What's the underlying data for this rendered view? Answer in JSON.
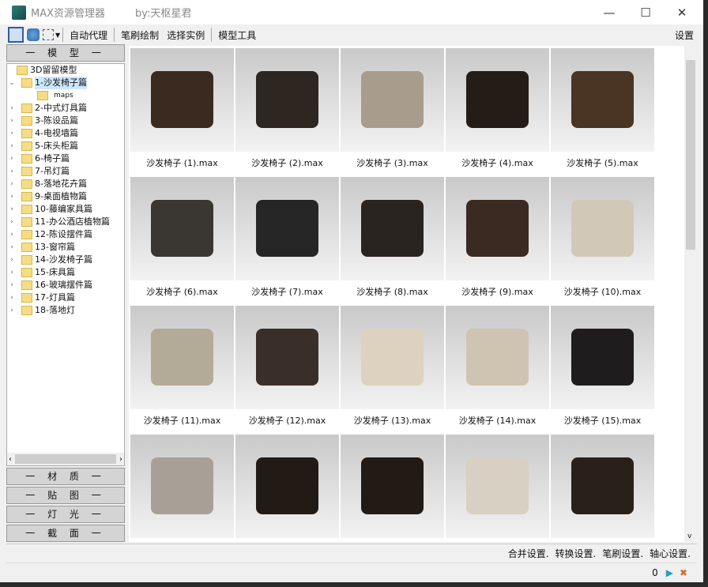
{
  "window": {
    "title": "MAX资源管理器",
    "author": "by:天枢星君",
    "minimize": "—",
    "maximize": "☐",
    "close": "✕"
  },
  "toolbar": {
    "items": [
      "自动代理",
      "笔刷绘制",
      "选择实例",
      "模型工具"
    ],
    "settings": "设置"
  },
  "left": {
    "model_header": "一 模 型 一",
    "root": "3D留留模型",
    "tree": [
      {
        "label": "1-沙发椅子篇",
        "expanded": true,
        "selected": true
      },
      {
        "label": "maps",
        "child": true
      },
      {
        "label": "2-中式灯具篇"
      },
      {
        "label": "3-陈设品篇"
      },
      {
        "label": "4-电视墙篇"
      },
      {
        "label": "5-床头柜篇"
      },
      {
        "label": "6-椅子篇"
      },
      {
        "label": "7-吊灯篇"
      },
      {
        "label": "8-落地花卉篇"
      },
      {
        "label": "9-桌面植物篇"
      },
      {
        "label": "10-藤编家具篇"
      },
      {
        "label": "11-办公酒店植物篇"
      },
      {
        "label": "12-陈设摆件篇"
      },
      {
        "label": "13-窗帘篇"
      },
      {
        "label": "14-沙发椅子篇"
      },
      {
        "label": "15-床具篇"
      },
      {
        "label": "16-玻璃摆件篇"
      },
      {
        "label": "17-灯具篇"
      },
      {
        "label": "18-落地灯"
      }
    ],
    "panels": [
      "一 材 质 一",
      "一 贴 图 一",
      "一 灯 光 一",
      "一 截 面 一"
    ]
  },
  "grid": {
    "items": [
      {
        "label": "沙发椅子 (1).max",
        "color": "#3b2a20"
      },
      {
        "label": "沙发椅子 (2).max",
        "color": "#2e2620"
      },
      {
        "label": "沙发椅子 (3).max",
        "color": "#a89c8c"
      },
      {
        "label": "沙发椅子 (4).max",
        "color": "#241c16"
      },
      {
        "label": "沙发椅子 (5).max",
        "color": "#4a3424"
      },
      {
        "label": "沙发椅子 (6).max",
        "color": "#3a3632"
      },
      {
        "label": "沙发椅子 (7).max",
        "color": "#262626"
      },
      {
        "label": "沙发椅子 (8).max",
        "color": "#2a2420"
      },
      {
        "label": "沙发椅子 (9).max",
        "color": "#3a2a22"
      },
      {
        "label": "沙发椅子 (10).max",
        "color": "#d2c8b8"
      },
      {
        "label": "沙发椅子 (11).max",
        "color": "#b4aa98"
      },
      {
        "label": "沙发椅子 (12).max",
        "color": "#3a2e28"
      },
      {
        "label": "沙发椅子 (13).max",
        "color": "#ddd2c0"
      },
      {
        "label": "沙发椅子 (14).max",
        "color": "#cfc4b2"
      },
      {
        "label": "沙发椅子 (15).max",
        "color": "#1e1c1c"
      },
      {
        "label": "",
        "color": "#a8a096"
      },
      {
        "label": "",
        "color": "#221a15"
      },
      {
        "label": "",
        "color": "#221a15"
      },
      {
        "label": "",
        "color": "#d8d0c2"
      },
      {
        "label": "",
        "color": "#2a201a"
      }
    ]
  },
  "bottom": {
    "items": [
      "合并设置.",
      "转换设置.",
      "笔刷设置.",
      "轴心设置."
    ]
  },
  "status": {
    "count": "0"
  }
}
